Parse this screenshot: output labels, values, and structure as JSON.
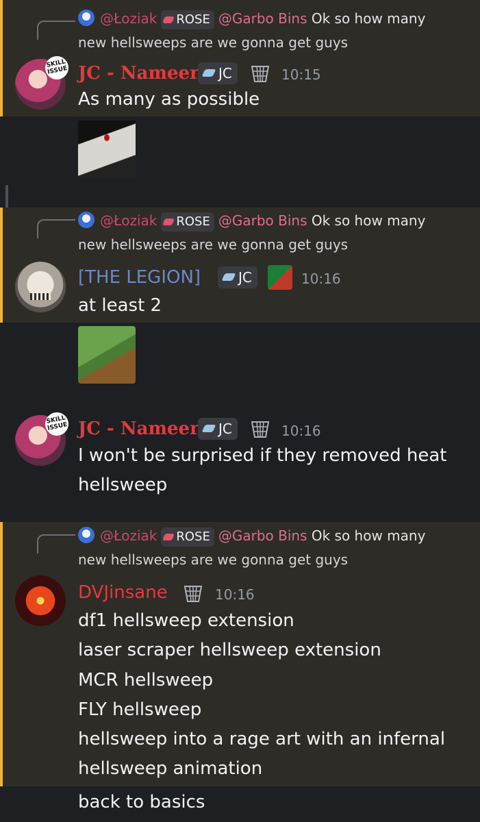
{
  "reply": {
    "author": "@Łoziak",
    "role_badge": "ROSE",
    "mention": "@Garbo Bins",
    "text_line1": "Ok so how many",
    "text_line2": "new hellsweeps are we gonna get guys"
  },
  "messages": [
    {
      "username": "JC - Nameer",
      "tag": "JC",
      "time": "10:15",
      "text": "As many as possible",
      "avatar_badge": "SKILL ISSUE",
      "role_icon": "basket-icon"
    },
    {
      "username": "[THE LEGION]",
      "tag": "JC",
      "time": "10:16",
      "text": "at least 2"
    },
    {
      "username": "JC - Nameer",
      "tag": "JC",
      "time": "10:16",
      "text_line1": "I won't be surprised if they removed heat",
      "text_line2": "hellsweep",
      "avatar_badge": "SKILL ISSUE"
    },
    {
      "username": "DVJinsane",
      "time": "10:16",
      "lines": [
        "df1 hellsweep extension",
        "laser scraper hellsweep extension",
        "MCR hellsweep",
        "FLY hellsweep",
        "hellsweep into a rage art with an infernal",
        "hellsweep animation",
        "back to basics"
      ]
    }
  ],
  "colors": {
    "background": "#1e1f22",
    "highlight": "#2e2c26",
    "highlight_bar": "#f0b232",
    "username_red": "#e5393f",
    "username_blue": "#6d88c8",
    "timestamp": "#949ba4"
  }
}
